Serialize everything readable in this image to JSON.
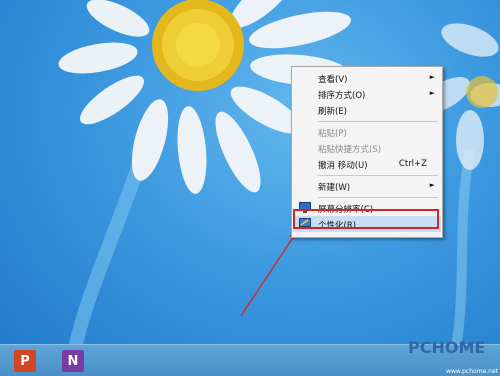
{
  "context_menu": {
    "items": [
      {
        "label": "查看(V)",
        "arrow": "►"
      },
      {
        "label": "排序方式(O)",
        "arrow": "►"
      },
      {
        "label": "刷新(E)"
      },
      {
        "label": "粘贴(P)"
      },
      {
        "label": "粘贴快捷方式(S)"
      },
      {
        "label": "撤消 移动(U)",
        "shortcut": "Ctrl+Z"
      },
      {
        "label": "新建(W)",
        "arrow": "►"
      },
      {
        "label": "屏幕分辨率(C)"
      },
      {
        "label": "个性化(R)"
      }
    ]
  },
  "taskbar": {
    "powerpoint_letter": "P",
    "onenote_letter": "N"
  },
  "watermark": {
    "brand": "PCHOME",
    "url": "www.pchome.net"
  },
  "colors": {
    "highlight_border": "#d32626",
    "menu_highlight": "#c9def5",
    "taskbar": "#4a8fc6"
  }
}
